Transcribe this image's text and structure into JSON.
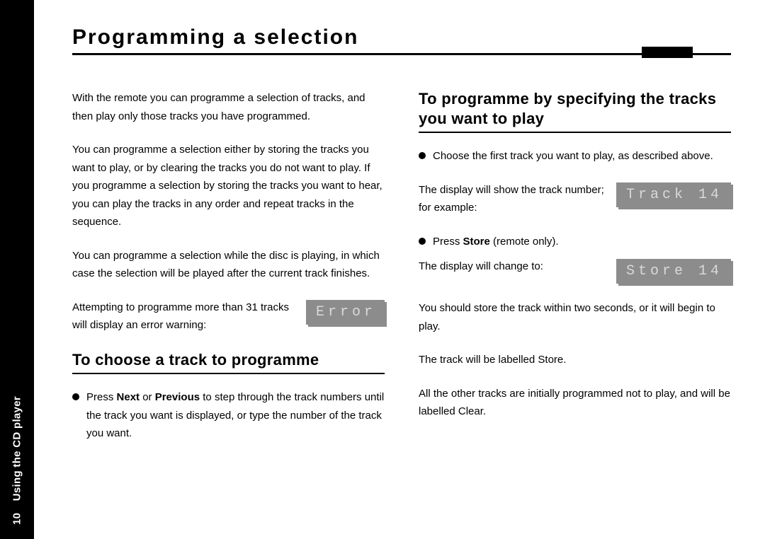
{
  "sidebar": {
    "section": "Using the CD player",
    "page_number": "10"
  },
  "title": "Programming a selection",
  "left": {
    "p1": "With the remote you can programme a selection of tracks, and then play only those tracks you have programmed.",
    "p2": "You can programme a selection either by storing the tracks you want to play, or by clearing the tracks you do not want to play. If you programme a selection by storing the tracks you want to hear, you can play the tracks in any order and repeat tracks in the sequence.",
    "p3": "You can programme a selection while the disc is playing, in which case the selection will be played after the current track finishes.",
    "p4": "Attempting to programme more than 31 tracks will display an error warning:",
    "lcd_error": "Error",
    "h2": "To choose a track to programme",
    "bullet_pre": "Press ",
    "bullet_b1": "Next",
    "bullet_mid": " or ",
    "bullet_b2": "Previous",
    "bullet_post": " to step through the track numbers until the track you want is displayed, or type the number of the track you want."
  },
  "right": {
    "h2": "To programme by specifying the tracks you want to play",
    "bullet1": "Choose the first track you want to play, as described above.",
    "p1": "The display will show the track number; for example:",
    "lcd_track": "Track 14",
    "bullet2_pre": "Press ",
    "bullet2_b": "Store",
    "bullet2_post": " (remote only).",
    "p2": "The display will change to:",
    "lcd_store": "Store 14",
    "p3": "You should store the track within two seconds, or it will begin to play.",
    "p4": "The track will be labelled Store.",
    "p5": "All the other tracks are initially programmed not to play, and will be labelled Clear."
  }
}
